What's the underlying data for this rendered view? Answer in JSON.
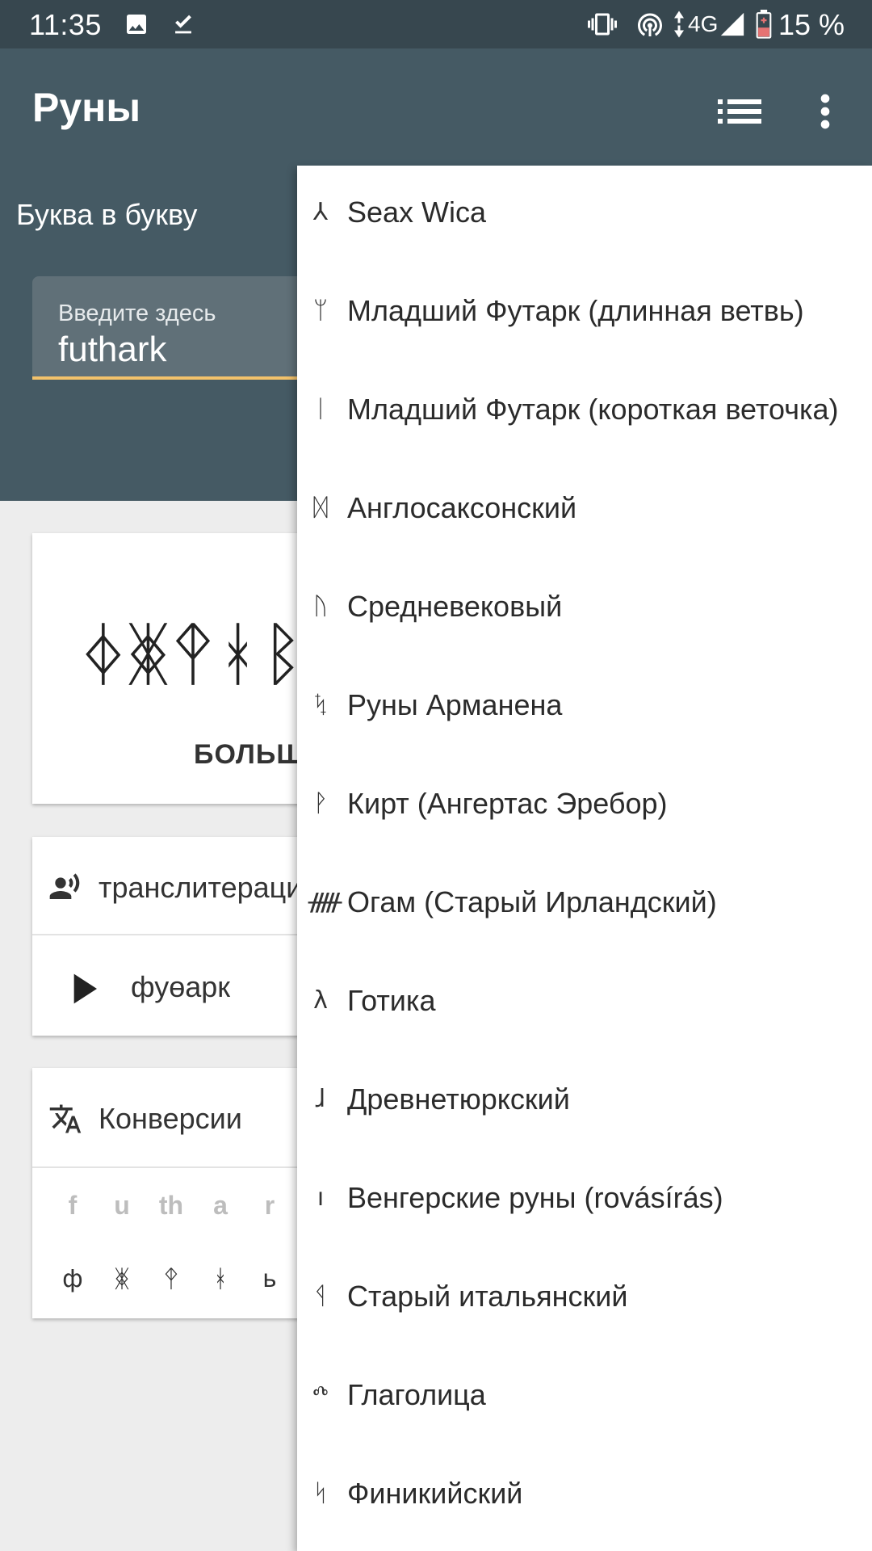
{
  "status_bar": {
    "time": "11:35",
    "battery_percent": "15 %",
    "network": "4G",
    "icons": [
      "image-icon",
      "download-done-icon",
      "vibrate-icon",
      "hotspot-icon",
      "data-arrows-icon",
      "signal-icon",
      "battery-icon"
    ]
  },
  "app_bar": {
    "title": "Руны",
    "icons": [
      "list-icon",
      "more-vert-icon"
    ]
  },
  "header": {
    "mode_label": "Буква в букву",
    "input": {
      "hint": "Введите здесь",
      "value": "futhark"
    }
  },
  "output_card": {
    "runes": "ᛄᛤᛳᚼᛒ",
    "caps_label": "БОЛЬШ"
  },
  "transliteration_card": {
    "label": "транслитераци",
    "play_text": "фуөарк"
  },
  "conversions_card": {
    "label": "Конверсии",
    "latin": [
      "f",
      "u",
      "th",
      "a",
      "r"
    ],
    "runes": [
      "ф",
      "ᛤ",
      "ᛳ",
      "ᚼ",
      "ь"
    ]
  },
  "menu": {
    "items": [
      {
        "glyph": "⅄",
        "label": "Seax Wica"
      },
      {
        "glyph": "ᛘ",
        "label": "Младший Футарк (длинная ветвь)"
      },
      {
        "glyph": "ᛁ",
        "label": "Младший Футарк (короткая веточка)"
      },
      {
        "glyph": "ᛞ",
        "label": "Англосаксонский"
      },
      {
        "glyph": "ᚢ",
        "label": "Средневековый"
      },
      {
        "glyph": "ᛪ",
        "label": "Руны Арманена"
      },
      {
        "glyph": "ᚹ",
        "label": "Кирт (Ангертас Эребор)"
      },
      {
        "glyph": "ᚏ",
        "label": "Огам (Старый Ирландский)"
      },
      {
        "glyph": "λ",
        "label": "Готика"
      },
      {
        "glyph": "ɺ",
        "label": "Древнетюркский"
      },
      {
        "glyph": "ı",
        "label": "Венгерские руны (rovásírás)"
      },
      {
        "glyph": "ᛩ",
        "label": "Старый итальянский"
      },
      {
        "glyph": "ⰴ",
        "label": "Глаголица"
      },
      {
        "glyph": "ᛋ",
        "label": "Финикийский"
      }
    ]
  },
  "colors": {
    "status_bar": "#37474f",
    "app_bar": "#455a64",
    "input_underline": "#f3c26b",
    "background": "#ededed"
  }
}
